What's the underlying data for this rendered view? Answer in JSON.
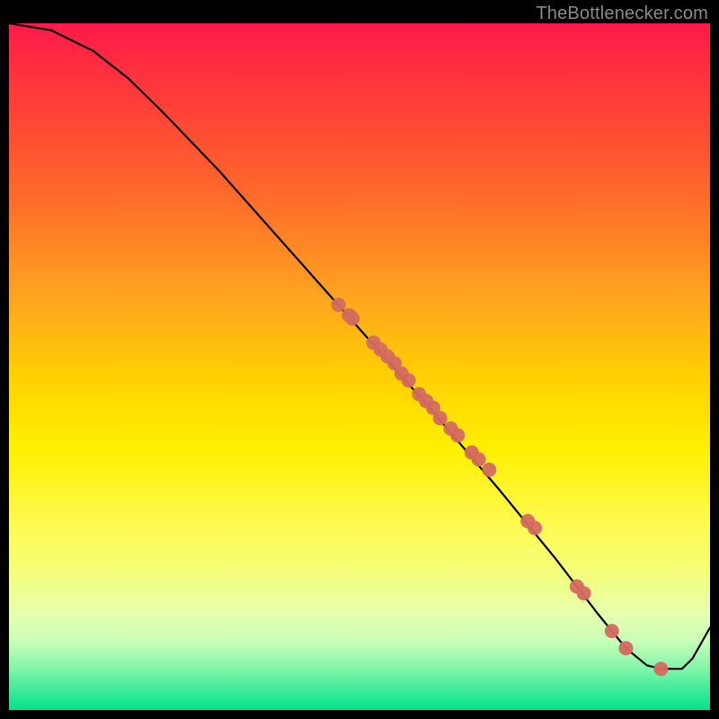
{
  "attribution": "TheBottlenecker.com",
  "chart_data": {
    "type": "line",
    "title": "",
    "xlabel": "",
    "ylabel": "",
    "xlim": [
      0,
      100
    ],
    "ylim": [
      0,
      100
    ],
    "curve": [
      {
        "x": 0,
        "y": 100
      },
      {
        "x": 6,
        "y": 99
      },
      {
        "x": 12,
        "y": 96
      },
      {
        "x": 17,
        "y": 92
      },
      {
        "x": 22,
        "y": 87
      },
      {
        "x": 30,
        "y": 78.5
      },
      {
        "x": 40,
        "y": 67
      },
      {
        "x": 50,
        "y": 55.5
      },
      {
        "x": 60,
        "y": 44
      },
      {
        "x": 70,
        "y": 32
      },
      {
        "x": 78,
        "y": 22
      },
      {
        "x": 84,
        "y": 14
      },
      {
        "x": 88,
        "y": 9
      },
      {
        "x": 91,
        "y": 6.5
      },
      {
        "x": 93,
        "y": 6
      },
      {
        "x": 96,
        "y": 6
      },
      {
        "x": 97.5,
        "y": 7.5
      },
      {
        "x": 100,
        "y": 12
      }
    ],
    "points": [
      {
        "x": 47,
        "y": 59
      },
      {
        "x": 48.5,
        "y": 57.5
      },
      {
        "x": 49,
        "y": 57
      },
      {
        "x": 52,
        "y": 53.5
      },
      {
        "x": 53,
        "y": 52.5
      },
      {
        "x": 54,
        "y": 51.5
      },
      {
        "x": 55,
        "y": 50.5
      },
      {
        "x": 56,
        "y": 49
      },
      {
        "x": 57,
        "y": 48
      },
      {
        "x": 58.5,
        "y": 46
      },
      {
        "x": 59.5,
        "y": 45
      },
      {
        "x": 60.5,
        "y": 44
      },
      {
        "x": 61.5,
        "y": 42.5
      },
      {
        "x": 63,
        "y": 41
      },
      {
        "x": 64,
        "y": 40
      },
      {
        "x": 66,
        "y": 37.5
      },
      {
        "x": 67,
        "y": 36.5
      },
      {
        "x": 68.5,
        "y": 35
      },
      {
        "x": 74,
        "y": 27.5
      },
      {
        "x": 75,
        "y": 26.5
      },
      {
        "x": 81,
        "y": 18
      },
      {
        "x": 82,
        "y": 17
      },
      {
        "x": 86,
        "y": 11.5
      },
      {
        "x": 88,
        "y": 9
      },
      {
        "x": 93,
        "y": 6
      }
    ],
    "point_radius_px": 8,
    "background_gradient": [
      "#ff1a4a",
      "#ffd200",
      "#fff94a",
      "#00e28c"
    ]
  }
}
